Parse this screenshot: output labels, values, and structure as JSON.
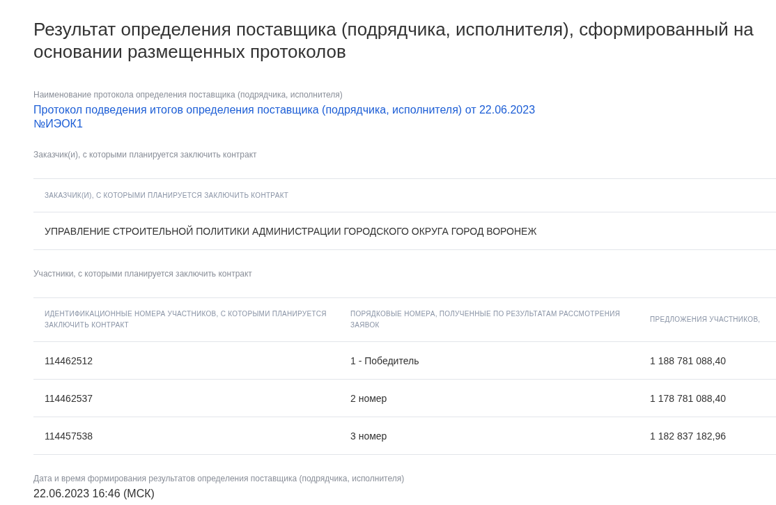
{
  "title": "Результат определения поставщика (подрядчика, исполнителя), сформированный на основании размещенных протоколов",
  "protocol": {
    "label": "Наименование протокола определения поставщика (подрядчика, исполнителя)",
    "value": "Протокол подведения итогов определения поставщика (подрядчика, исполнителя) от 22.06.2023 №ИЭОК1"
  },
  "customers": {
    "label": "Заказчик(и), с которыми планируется заключить контракт",
    "columns": [
      "ЗАКАЗЧИК(И), С КОТОРЫМИ ПЛАНИРУЕТСЯ ЗАКЛЮЧИТЬ КОНТРАКТ"
    ],
    "rows": [
      [
        "УПРАВЛЕНИЕ СТРОИТЕЛЬНОЙ ПОЛИТИКИ АДМИНИСТРАЦИИ ГОРОДСКОГО ОКРУГА ГОРОД ВОРОНЕЖ"
      ]
    ]
  },
  "participants": {
    "label": "Участники, с которыми планируется заключить контракт",
    "columns": [
      "ИДЕНТИФИКАЦИОННЫЕ НОМЕРА УЧАСТНИКОВ, С КОТОРЫМИ ПЛАНИРУЕТСЯ ЗАКЛЮЧИТЬ КОНТРАКТ",
      "ПОРЯДКОВЫЕ НОМЕРА, ПОЛУЧЕННЫЕ ПО РЕЗУЛЬТАТАМ РАССМОТРЕНИЯ ЗАЯВОК",
      "ПРЕДЛОЖЕНИЯ УЧАСТНИКОВ,"
    ],
    "rows": [
      [
        "114462512",
        "1 - Победитель",
        "1 188 781 088,40"
      ],
      [
        "114462537",
        "2 номер",
        "1 178 781 088,40"
      ],
      [
        "114457538",
        "3 номер",
        "1 182 837 182,96"
      ]
    ]
  },
  "result_date": {
    "label": "Дата и время формирования результатов определения поставщика (подрядчика, исполнителя)",
    "value": "22.06.2023 16:46 (МСК)"
  }
}
